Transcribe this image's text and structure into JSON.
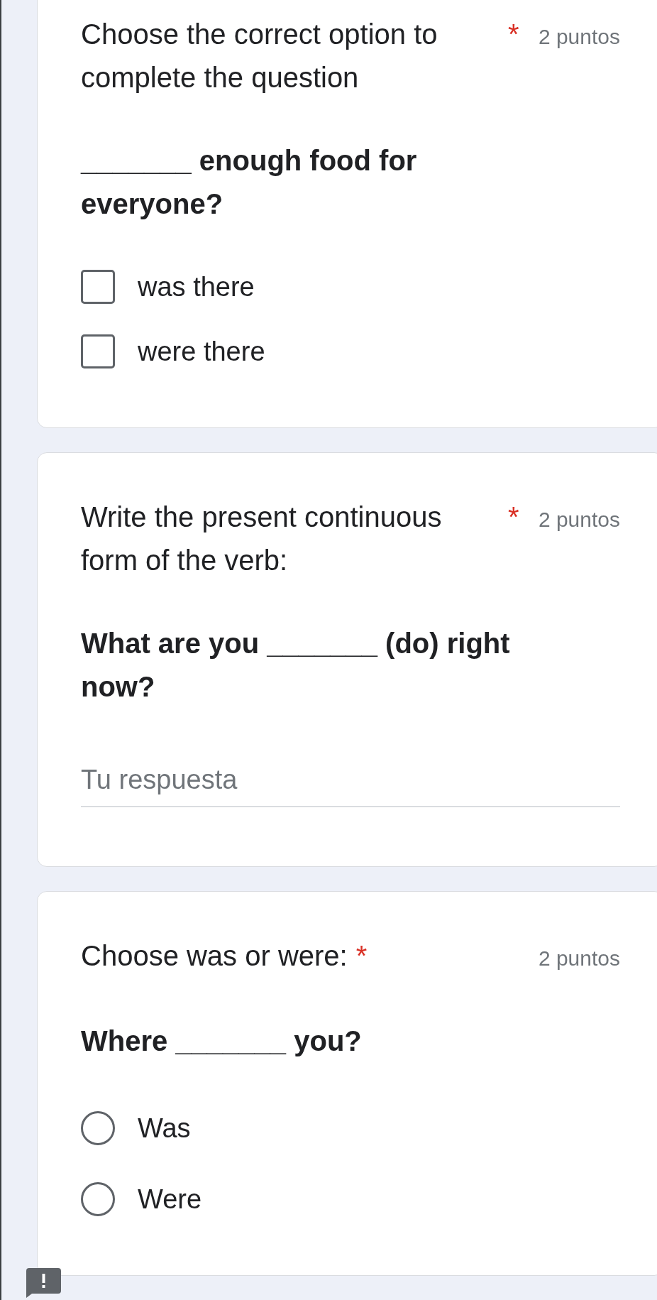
{
  "questions": [
    {
      "kind": "checkbox",
      "title": "Choose the correct option to complete the question",
      "required_mark": "*",
      "points": "2 puntos",
      "prompt": "_______ enough food for everyone?",
      "options": [
        {
          "label": "was there",
          "checked": false
        },
        {
          "label": "were there",
          "checked": false
        }
      ]
    },
    {
      "kind": "text",
      "title": "Write the present continuous form of the verb:",
      "required_mark": "*",
      "points": "2 puntos",
      "prompt": "What are you _______ (do) right now?",
      "answer": {
        "placeholder": "Tu respuesta"
      }
    },
    {
      "kind": "radio",
      "title": "Choose was or were:",
      "required_mark": "*",
      "points": "2 puntos",
      "prompt": "Where _______ you?",
      "options": [
        {
          "label": "Was",
          "selected": false
        },
        {
          "label": "Were",
          "selected": false
        }
      ]
    }
  ]
}
